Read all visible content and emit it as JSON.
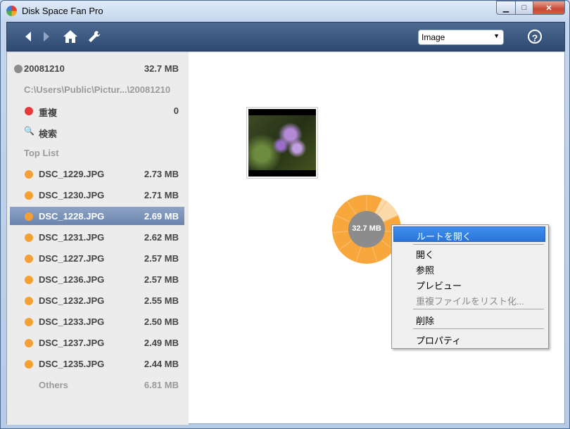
{
  "window": {
    "title": "Disk Space Fan Pro"
  },
  "titlebar": {
    "min": "▁",
    "max": "□",
    "close": "✕"
  },
  "toolbar": {
    "view_select": "Image",
    "help": "?"
  },
  "sidebar": {
    "root": {
      "label": "20081210",
      "size": "32.7 MB"
    },
    "path": "C:\\Users\\Public\\Pictur...\\20081210",
    "duplicates": {
      "label": "重複",
      "count": "0"
    },
    "search": {
      "label": "検索"
    },
    "top_list_header": "Top List",
    "files": [
      {
        "name": "DSC_1229.JPG",
        "size": "2.73 MB"
      },
      {
        "name": "DSC_1230.JPG",
        "size": "2.71 MB"
      },
      {
        "name": "DSC_1228.JPG",
        "size": "2.69 MB"
      },
      {
        "name": "DSC_1231.JPG",
        "size": "2.62 MB"
      },
      {
        "name": "DSC_1227.JPG",
        "size": "2.57 MB"
      },
      {
        "name": "DSC_1236.JPG",
        "size": "2.57 MB"
      },
      {
        "name": "DSC_1232.JPG",
        "size": "2.55 MB"
      },
      {
        "name": "DSC_1233.JPG",
        "size": "2.50 MB"
      },
      {
        "name": "DSC_1237.JPG",
        "size": "2.49 MB"
      },
      {
        "name": "DSC_1235.JPG",
        "size": "2.44 MB"
      }
    ],
    "others": {
      "label": "Others",
      "size": "6.81 MB"
    }
  },
  "chart": {
    "center_label": "32.7 MB"
  },
  "context_menu": {
    "items": [
      "ルートを開く",
      "開く",
      "参照",
      "プレビュー",
      "重複ファイルをリスト化...",
      "削除",
      "プロパティ"
    ]
  },
  "colors": {
    "file_dot": "#f5a033",
    "dup_dot": "#e63a3a",
    "selected_row": "#7a91b8",
    "menu_highlight": "#3a87ea"
  }
}
